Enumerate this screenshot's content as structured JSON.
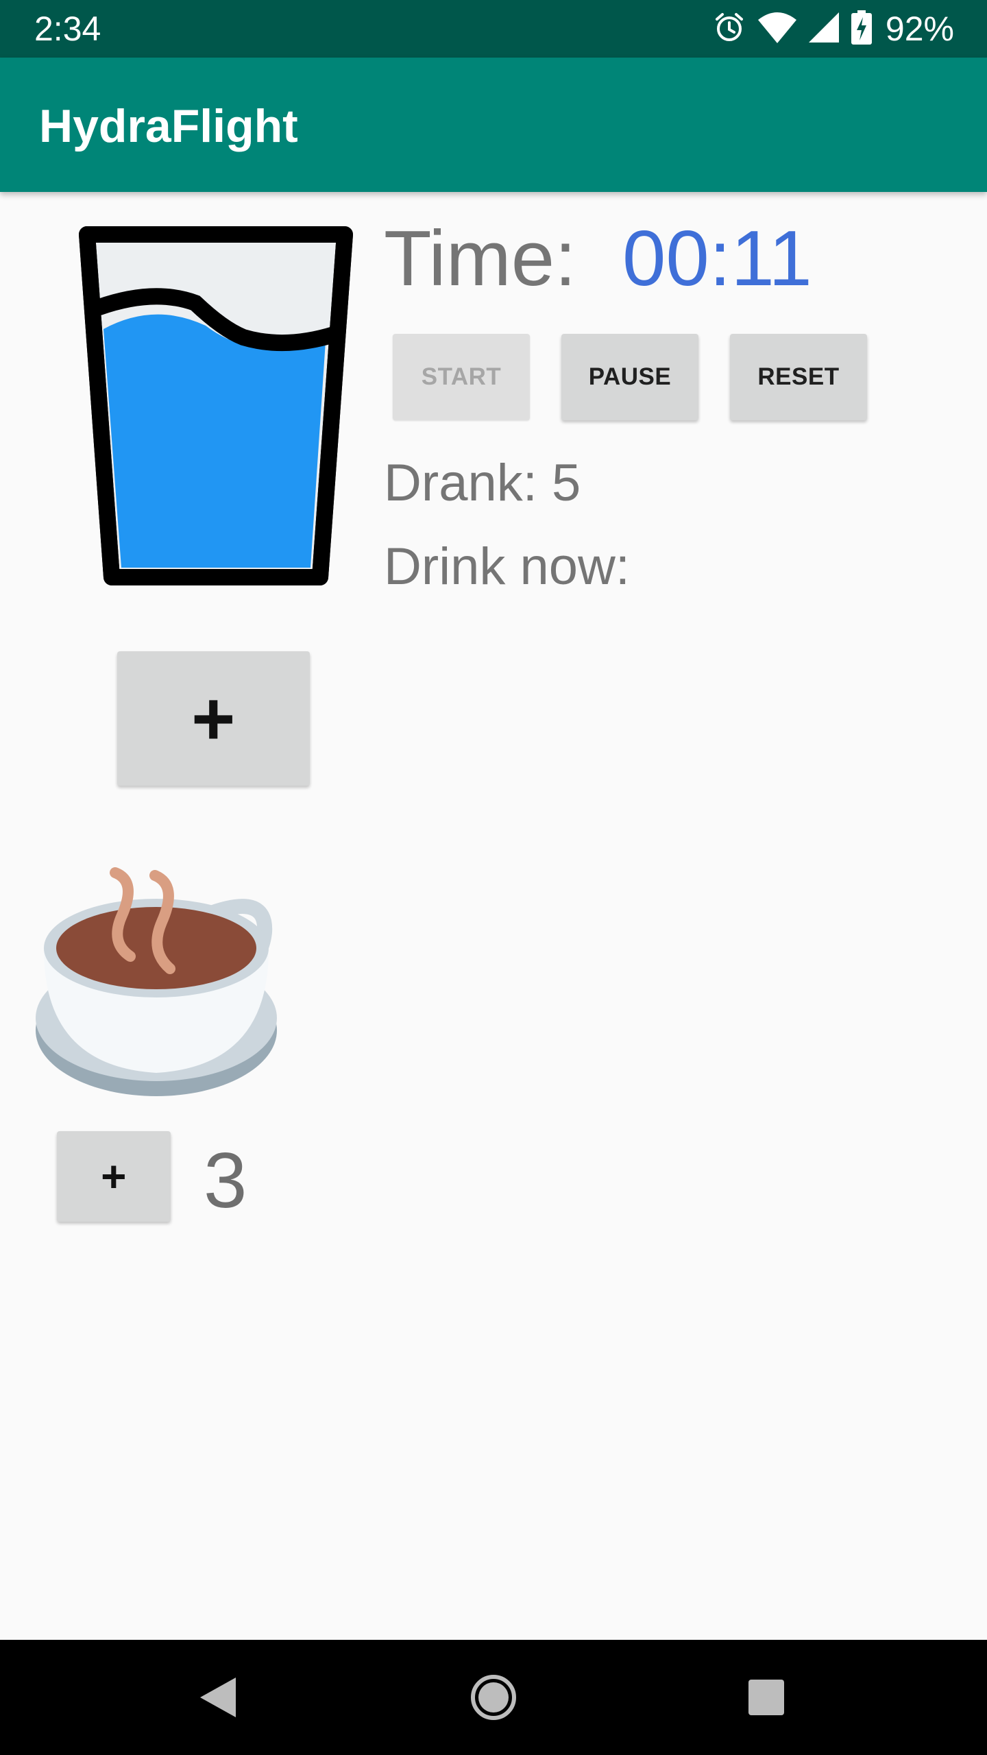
{
  "status_bar": {
    "time": "2:34",
    "battery_percent": "92%",
    "icons": [
      "alarm-icon",
      "wifi-icon",
      "signal-icon",
      "battery-charging-icon"
    ]
  },
  "app_bar": {
    "title": "HydraFlight",
    "color": "#008577"
  },
  "timer": {
    "label": "Time:",
    "value": "00:11",
    "value_color": "#3f6fd8"
  },
  "controls": {
    "start_label": "START",
    "pause_label": "PAUSE",
    "reset_label": "RESET",
    "start_enabled": false
  },
  "stats": {
    "drank_text": "Drank: 5",
    "drink_now_text": "Drink now:"
  },
  "water": {
    "icon": "water-glass-icon",
    "add_label": "+"
  },
  "coffee": {
    "icon": "coffee-cup-icon",
    "add_label": "+",
    "count": "3"
  },
  "nav_bar": {
    "icons": [
      "back-icon",
      "home-icon",
      "recents-icon"
    ]
  }
}
